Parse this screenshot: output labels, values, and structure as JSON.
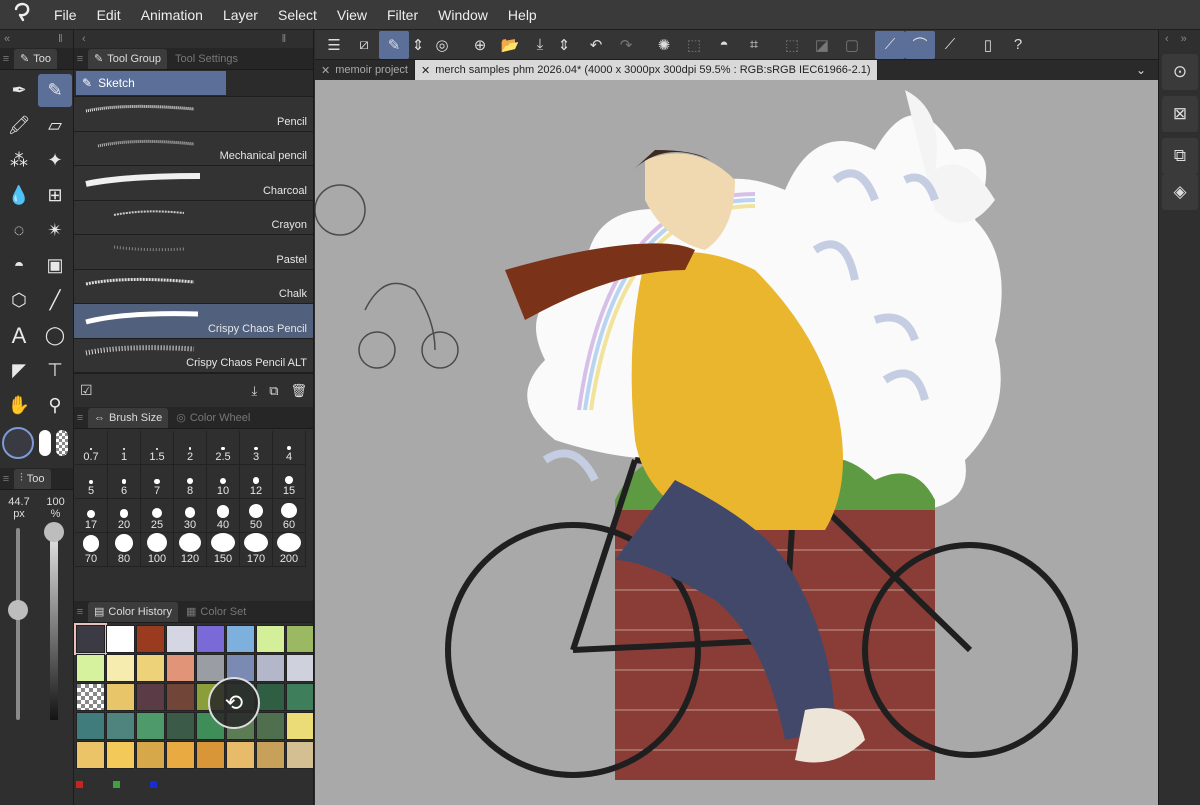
{
  "menubar": {
    "logo_icon": "app-logo-icon",
    "items": [
      "File",
      "Edit",
      "Animation",
      "Layer",
      "Select",
      "View",
      "Filter",
      "Window",
      "Help"
    ]
  },
  "toolbox": {
    "tab_label": "Too",
    "tools": [
      "pen-icon",
      "pencil-icon",
      "marker-icon",
      "eraser-icon",
      "airbrush-icon",
      "sparkle-icon",
      "blend-icon",
      "mesh-icon",
      "lasso-icon",
      "magic-wand-icon",
      "fill-icon",
      "gradient-icon",
      "3d-object-icon",
      "line-icon",
      "text-icon",
      "balloon-icon",
      "ruler-icon",
      "correct-line-icon",
      "hand-icon",
      "eyedropper-icon"
    ],
    "active_tool_index": 1,
    "color_primary": "#3a3a42",
    "tool_property_tab": "Too",
    "brush_size_value": "44.7",
    "brush_size_unit": "px",
    "opacity_value": "100",
    "opacity_unit": "%"
  },
  "tool_group": {
    "tab_active": "Tool Group",
    "tab_inactive": "Tool Settings",
    "group_name": "Sketch",
    "brushes": [
      "Pencil",
      "Mechanical pencil",
      "Charcoal",
      "Crayon",
      "Pastel",
      "Chalk",
      "Crispy Chaos Pencil",
      "Crispy Chaos Pencil ALT"
    ],
    "active_index": 6
  },
  "brush_size_panel": {
    "tab_active": "Brush Size",
    "tab_inactive": "Color Wheel",
    "sizes": [
      "0.7",
      "1",
      "1.5",
      "2",
      "2.5",
      "3",
      "4",
      "5",
      "6",
      "7",
      "8",
      "10",
      "12",
      "15",
      "17",
      "20",
      "25",
      "30",
      "40",
      "50",
      "60",
      "70",
      "80",
      "100",
      "120",
      "150",
      "170",
      "200"
    ]
  },
  "color_panel": {
    "tab_active": "Color History",
    "tab_inactive": "Color Set",
    "swatches": [
      "#3c3b43",
      "#ffffff",
      "#9a3b20",
      "#d4d6e4",
      "#7a6ad8",
      "#7db0dc",
      "#d3ef9a",
      "#9bb862",
      "#d6f29e",
      "#f6ecb0",
      "#edd27a",
      "#e19478",
      "#9a9ea4",
      "#7b8ab2",
      "#b3b7c9",
      "#cfd1dd",
      "transparent",
      "#e9c56a",
      "#5b3b45",
      "#714538",
      "#8a9e3a",
      "#3e6d40",
      "#2f5e42",
      "#3f7e5a",
      "#3f7c7b",
      "#4f837d",
      "#4f9a6a",
      "#3b5a48",
      "#3f8e5a",
      "#5b7c54",
      "#4f6f4f",
      "#ecdc78",
      "#ecc468",
      "#f3c95a",
      "#d6a84a",
      "#eaaa42",
      "#d99638",
      "#e8bb6a",
      "#c7a05a",
      "#d4bf92"
    ],
    "indicator_colors": [
      "#c8231f",
      "#3ca23c",
      "#1a2bd0"
    ]
  },
  "command_bar": {
    "icons": [
      "menu-icon",
      "canvas-icon",
      "modify-icon",
      "toggle-icon",
      "new-icon",
      "new-file-icon",
      "open-icon",
      "save-icon",
      "export-icon",
      "undo-icon",
      "redo-icon",
      "loading-icon",
      "selection-icon",
      "fill-icon",
      "crop-icon",
      "clear-selection-icon",
      "invert-icon",
      "border-icon",
      "snap-ruler-icon",
      "snap-special-icon",
      "snap-grid-icon",
      "device-icon",
      "help-icon"
    ]
  },
  "tabs": [
    {
      "label": "memoir project"
    },
    {
      "label": "merch samples phm 2026.04* (4000 x 3000px 300dpi 59.5% : RGB:sRGB IEC61966-2.1)"
    }
  ],
  "right_bar": {
    "icons": [
      "navigator-icon",
      "layer-property-icon",
      "layer-search-icon",
      "layers-icon"
    ]
  }
}
